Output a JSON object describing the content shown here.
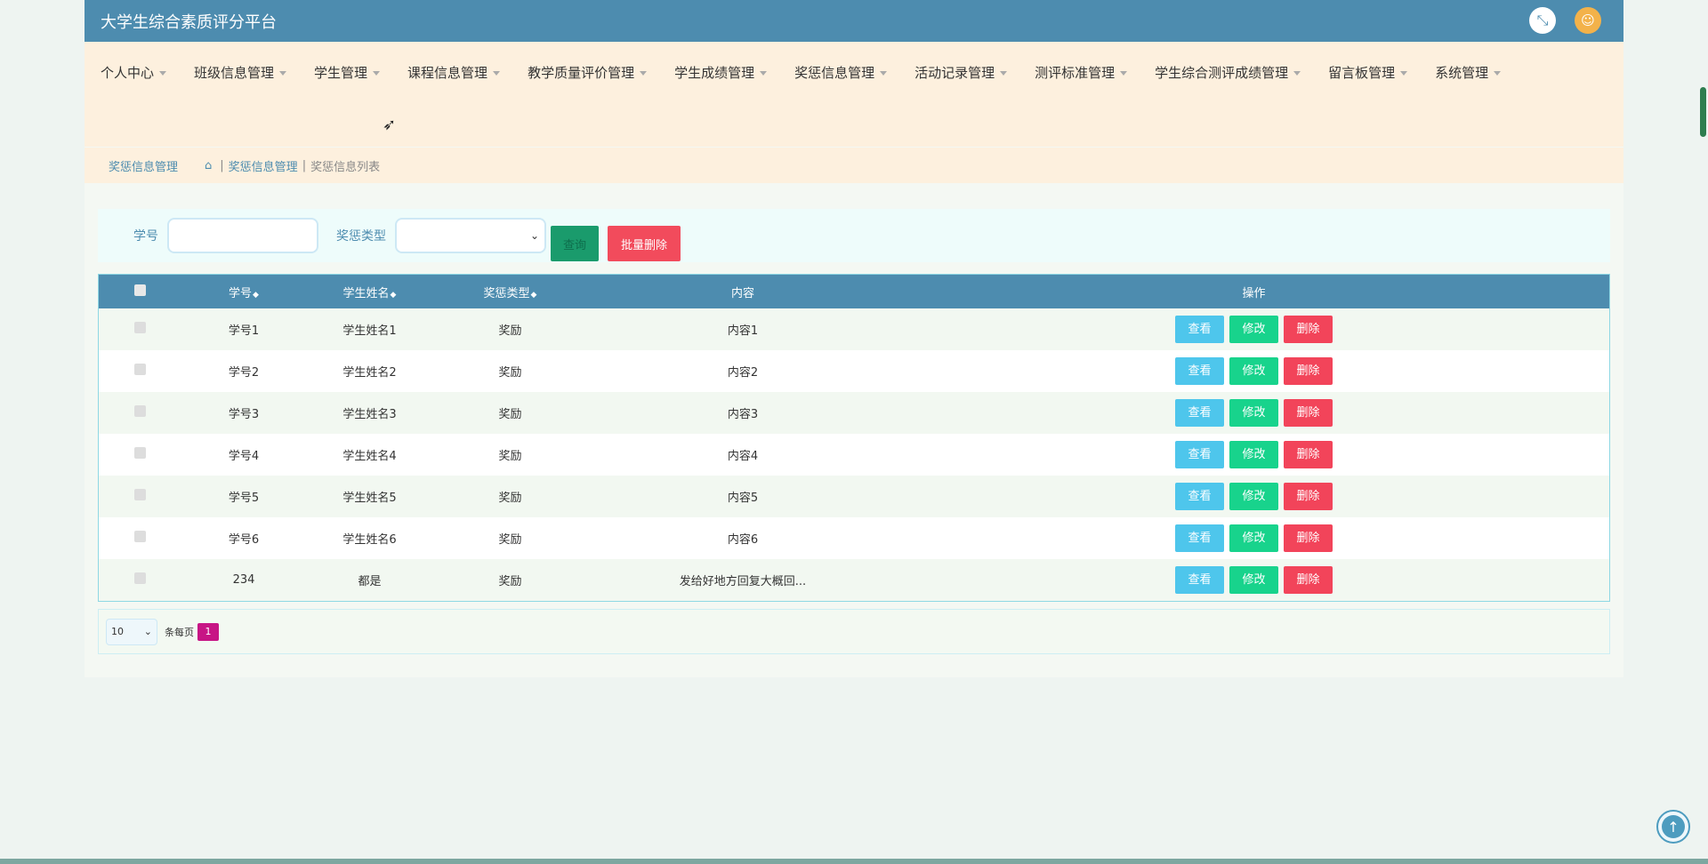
{
  "app": {
    "title": "大学生综合素质评分平台"
  },
  "nav": [
    {
      "label": "个人中心"
    },
    {
      "label": "班级信息管理"
    },
    {
      "label": "学生管理"
    },
    {
      "label": "课程信息管理"
    },
    {
      "label": "教学质量评价管理"
    },
    {
      "label": "学生成绩管理"
    },
    {
      "label": "奖惩信息管理"
    },
    {
      "label": "活动记录管理"
    },
    {
      "label": "测评标准管理"
    },
    {
      "label": "学生综合测评成绩管理"
    },
    {
      "label": "留言板管理"
    },
    {
      "label": "系统管理"
    }
  ],
  "breadcrumb": {
    "section": "奖惩信息管理",
    "path1": "奖惩信息管理",
    "path2": "奖惩信息列表",
    "separator": "|"
  },
  "search": {
    "student_id_label": "学号",
    "type_label": "奖惩类型",
    "query_button": "查询",
    "batch_delete_button": "批量删除"
  },
  "table": {
    "headers": {
      "student_id": "学号",
      "student_name": "学生姓名",
      "type": "奖惩类型",
      "content": "内容",
      "actions": "操作"
    },
    "rows": [
      {
        "student_id": "学号1",
        "student_name": "学生姓名1",
        "type": "奖励",
        "content": "内容1"
      },
      {
        "student_id": "学号2",
        "student_name": "学生姓名2",
        "type": "奖励",
        "content": "内容2"
      },
      {
        "student_id": "学号3",
        "student_name": "学生姓名3",
        "type": "奖励",
        "content": "内容3"
      },
      {
        "student_id": "学号4",
        "student_name": "学生姓名4",
        "type": "奖励",
        "content": "内容4"
      },
      {
        "student_id": "学号5",
        "student_name": "学生姓名5",
        "type": "奖励",
        "content": "内容5"
      },
      {
        "student_id": "学号6",
        "student_name": "学生姓名6",
        "type": "奖励",
        "content": "内容6"
      },
      {
        "student_id": "234",
        "student_name": "都是",
        "type": "奖励",
        "content": "发给好地方回复大概回..."
      }
    ],
    "actions": {
      "view": "查看",
      "edit": "修改",
      "delete": "删除"
    }
  },
  "pager": {
    "page_size": "10",
    "per_page_label": "条每页",
    "current_page": "1"
  },
  "colors": {
    "header_bg": "#4d8caf",
    "nav_bg": "#fdf0de",
    "view": "#4ec6ec",
    "edit": "#18d38c",
    "delete": "#f2445a",
    "page_active": "#c71585"
  }
}
